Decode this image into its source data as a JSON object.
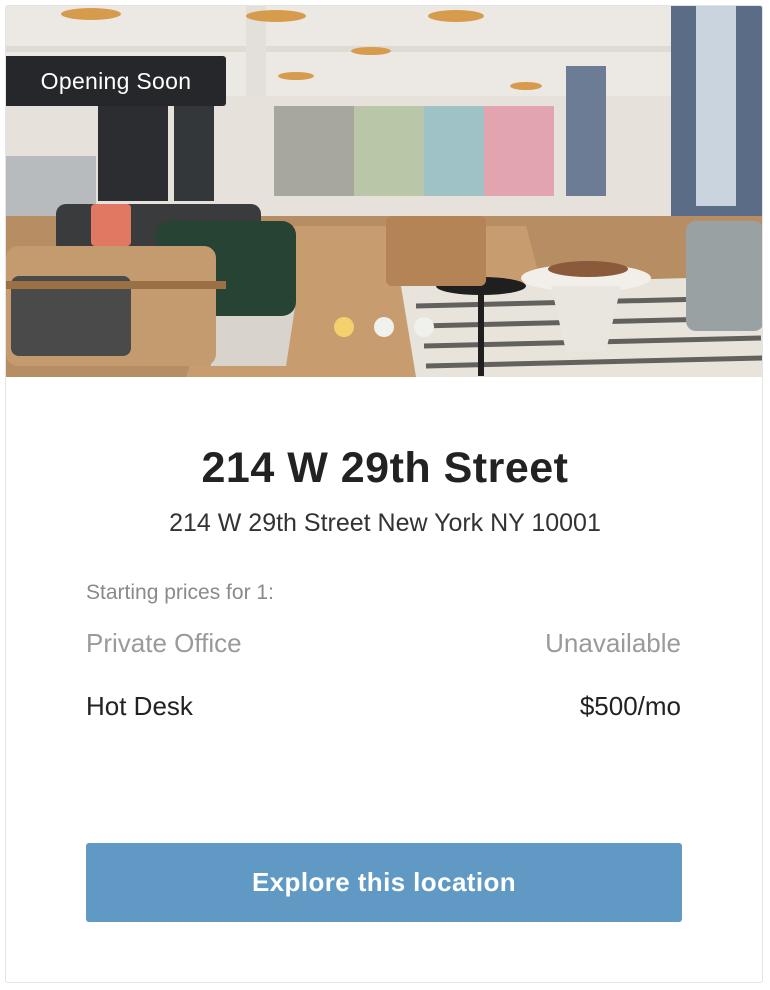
{
  "badge": {
    "label": "Opening Soon"
  },
  "carousel": {
    "slide_count": 3,
    "active_index": 0
  },
  "location": {
    "title": "214 W 29th Street",
    "address": "214 W 29th Street New York NY 10001"
  },
  "pricing": {
    "label": "Starting prices for 1:",
    "items": [
      {
        "name": "Private Office",
        "price": "Unavailable",
        "available": false
      },
      {
        "name": "Hot Desk",
        "price": "$500/mo",
        "available": true
      }
    ]
  },
  "cta": {
    "label": "Explore this location"
  },
  "colors": {
    "badge_bg": "#25272a",
    "active_dot": "#f5d16e",
    "cta_bg": "#5f99c4"
  }
}
